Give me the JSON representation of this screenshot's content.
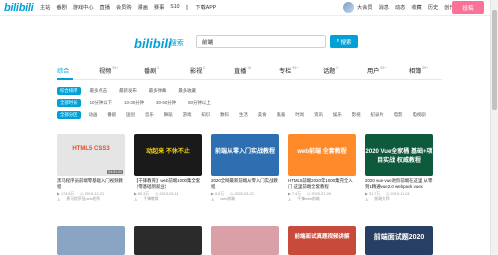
{
  "topbar": {
    "logo": "bilibili",
    "nav": [
      "主站",
      "番剧",
      "游戏中心",
      "直播",
      "会员购",
      "漫画",
      "赛事",
      "S10"
    ],
    "app_label": "下载APP",
    "right": [
      "大会员",
      "消息",
      "动态",
      "收藏",
      "历史",
      "创作中心"
    ],
    "upload_label": "投稿"
  },
  "search": {
    "logo": "bilibili",
    "logo_suffix": "| 搜索",
    "query": "前端",
    "button_label": "搜索"
  },
  "tabs": [
    {
      "label": "综合",
      "count": "",
      "active": true
    },
    {
      "label": "视频",
      "count": "99+",
      "active": false
    },
    {
      "label": "番剧",
      "count": "0",
      "active": false
    },
    {
      "label": "影视",
      "count": "0",
      "active": false
    },
    {
      "label": "直播",
      "count": "15",
      "active": false
    },
    {
      "label": "专栏",
      "count": "99+",
      "active": false
    },
    {
      "label": "话题",
      "count": "0",
      "active": false
    },
    {
      "label": "用户",
      "count": "99+",
      "active": false
    },
    {
      "label": "相簿",
      "count": "99+",
      "active": false
    }
  ],
  "filters": {
    "sort": [
      "综合排序",
      "最多点击",
      "最新发布",
      "最多弹幕",
      "最多收藏"
    ],
    "duration": [
      "全部时长",
      "10分钟以下",
      "10-30分钟",
      "30-60分钟",
      "60分钟以上"
    ],
    "zone": [
      "全部分区",
      "动画",
      "番剧",
      "国创",
      "音乐",
      "舞蹈",
      "游戏",
      "知识",
      "数码",
      "生活",
      "美食",
      "鬼畜",
      "时尚",
      "资讯",
      "娱乐",
      "影视",
      "纪录片",
      "电影",
      "电视剧"
    ]
  },
  "cards_row1": [
    {
      "title": "黑马程序员前端零基础入门视频教程",
      "duration": "54:51:02",
      "views": "174.8万",
      "date": "2019-12-21",
      "author": "黑马程序员pink老师",
      "thumb_text": "HTML5 CSS3",
      "thumb_color": "#e5e5e5"
    },
    {
      "title": "【千锋教育】web前端1000集全套（零基础到就业）",
      "duration": "",
      "views": "80.3万",
      "date": "2019-03-11",
      "author": "千锋教育",
      "thumb_text": "动起来 不休不止",
      "thumb_color": "#1a1a1a"
    },
    {
      "title": "2020全网最新前端从零入门实战教程",
      "duration": "",
      "views": "5.5万",
      "date": "2020-03-22",
      "author": "web前端",
      "thumb_text": "前端从零入门实战教程",
      "thumb_color": "#2d6fb0"
    },
    {
      "title": "HTML5前端2020年1000集完全入门 这里前端全套教程",
      "duration": "",
      "views": "7.4万",
      "date": "2020-07-09",
      "author": "千锋web前端",
      "thumb_text": "web前端 全套教程",
      "thumb_color": "#ff8a2a"
    },
    {
      "title": "2020 vue-vue进阶前端在这里 从零到1精通vue2.0 webpack vuex",
      "duration": "",
      "views": "31.7万",
      "date": "2019-11-01",
      "author": "前端大师",
      "thumb_text": "2020 Vue全家桶 基础+项目实战 权威教程",
      "thumb_color": "#0e5a3c"
    }
  ],
  "cards_row2": [
    {
      "thumb_text": "",
      "thumb_color": "#8aa5c4"
    },
    {
      "thumb_text": "",
      "thumb_color": "#2b2b2b"
    },
    {
      "thumb_text": "",
      "thumb_color": "#d9a0a8"
    },
    {
      "thumb_text": "前端面试真题视频讲解",
      "thumb_color": "#c84a3a"
    },
    {
      "thumb_text": "",
      "thumb_color": "#1e2a3a"
    },
    {
      "thumb_text": "前端面试题2020",
      "thumb_color": "#273f62"
    }
  ],
  "colors": {
    "accent": "#00a1d6",
    "pink": "#fb7299"
  }
}
